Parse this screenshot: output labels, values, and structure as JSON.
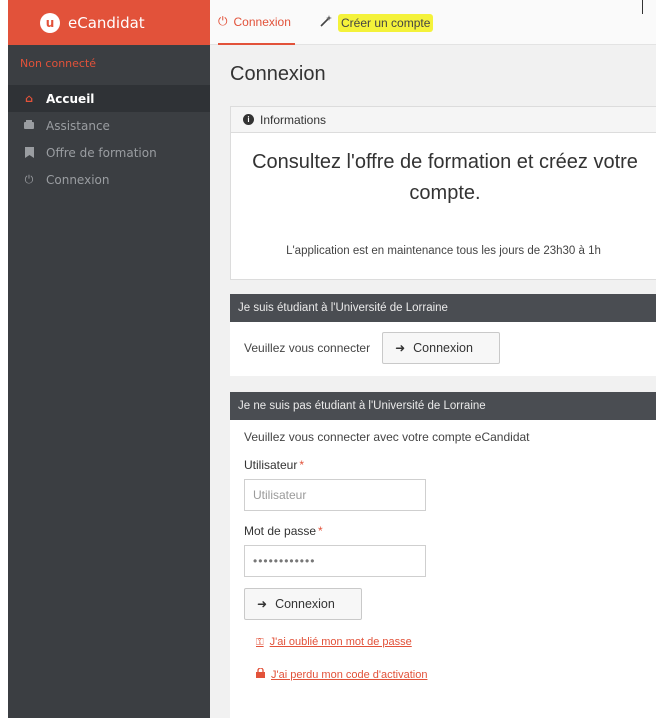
{
  "app": {
    "logo_letter": "u",
    "name": "eCandidat",
    "status": "Non connecté"
  },
  "sidebar": {
    "items": [
      {
        "label": "Accueil"
      },
      {
        "label": "Assistance"
      },
      {
        "label": "Offre de formation"
      },
      {
        "label": "Connexion"
      }
    ]
  },
  "tabs": [
    {
      "label": "Connexion"
    },
    {
      "label": "Créer un compte"
    }
  ],
  "main": {
    "title": "Connexion",
    "info": {
      "header": "Informations",
      "headline": "Consultez l'offre de formation et créez votre compte.",
      "notice": "L'application est en maintenance tous les jours de 23h30 à 1h"
    },
    "student": {
      "header": "Je suis étudiant à l'Université de Lorraine",
      "prompt": "Veuillez vous connecter",
      "button": "Connexion"
    },
    "non_student": {
      "header": "Je ne suis pas étudiant à l'Université de Lorraine",
      "prompt": "Veuillez vous connecter avec votre compte eCandidat",
      "user_label": "Utilisateur",
      "user_placeholder": "Utilisateur",
      "password_label": "Mot de passe",
      "password_value": "••••••••••••",
      "required_mark": "*",
      "button": "Connexion",
      "forgot_password": "J'ai oublié mon mot de passe",
      "lost_code": "J'ai perdu mon code d'activation"
    }
  },
  "colors": {
    "accent": "#e2523a",
    "sidebar_bg": "#3b3e42",
    "panel_header_dark": "#4a4d52",
    "highlight": "#f4f23a"
  }
}
